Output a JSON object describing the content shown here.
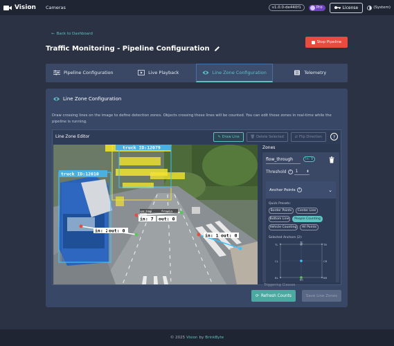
{
  "nav": {
    "brand": "Vision",
    "cameras": "Cameras",
    "version": "v1.0.0-de440f1",
    "pro": "Pro",
    "license": "License",
    "theme": "(System)"
  },
  "header": {
    "back": "Back to Dashboard",
    "title": "Traffic Monitoring - Pipeline Configuration",
    "stop": "Stop Pipeline"
  },
  "tabs": [
    {
      "label": "Pipeline Configuration",
      "icon": "sliders-icon"
    },
    {
      "label": "Live Playback",
      "icon": "play-icon"
    },
    {
      "label": "Line Zone Configuration",
      "icon": "eye-icon",
      "active": true
    },
    {
      "label": "Telemetry",
      "icon": "list-icon"
    }
  ],
  "card": {
    "title": "Line Zone Configuration",
    "description": "Draw crossing lines on the image to define detection zones. Objects crossing these lines will be counted. You can edit these zones in real-time while the pipeline is running."
  },
  "editor": {
    "title": "Line Zone Editor",
    "draw_line": "Draw Line",
    "delete_selected": "Delete Selected",
    "flip_direction": "Flip Direction",
    "help": "?"
  },
  "video": {
    "labels": {
      "truck_top": "truck  ID:12079",
      "truck_left": "truck  ID:12010",
      "in1": "in: 7",
      "out1": "out: 0",
      "in2": "in: 22",
      "out2": "out: 0",
      "in3": "in: 1",
      "out3": "out: 0",
      "lane_tag": "us_hmp_____frowin"
    }
  },
  "zones": {
    "title": "Zones",
    "zone_name": "flow_through",
    "in_badge": "In: 9",
    "threshold_label": "Threshold",
    "threshold_value": "1",
    "anchor_title": "Anchor Points",
    "presets_label": "Quick Presets:",
    "presets": [
      "Border Points",
      "Center Line",
      "Bottom Line",
      "People Counting",
      "Vehicle Counting",
      "All Points"
    ],
    "active_preset": "People Counting",
    "selected_label": "Selected Anchors (2):",
    "grid_labels": {
      "tl": "TL",
      "tc": "TC",
      "tr": "TR",
      "cl": "CL",
      "cr": "CR",
      "bl": "BL",
      "bc": "BC",
      "br": "BR"
    },
    "tracking": "Triggering Classes"
  },
  "actions": {
    "refresh": "Refresh Counts",
    "save": "Save Line Zones"
  },
  "footer": {
    "copyright": "© 2025",
    "app": "Vision",
    "by": "by",
    "company": "BrinkByte"
  },
  "colors": {
    "accent": "#5ec2c2",
    "danger": "#e74c3c",
    "background": "#2b3243",
    "card": "#384766"
  }
}
